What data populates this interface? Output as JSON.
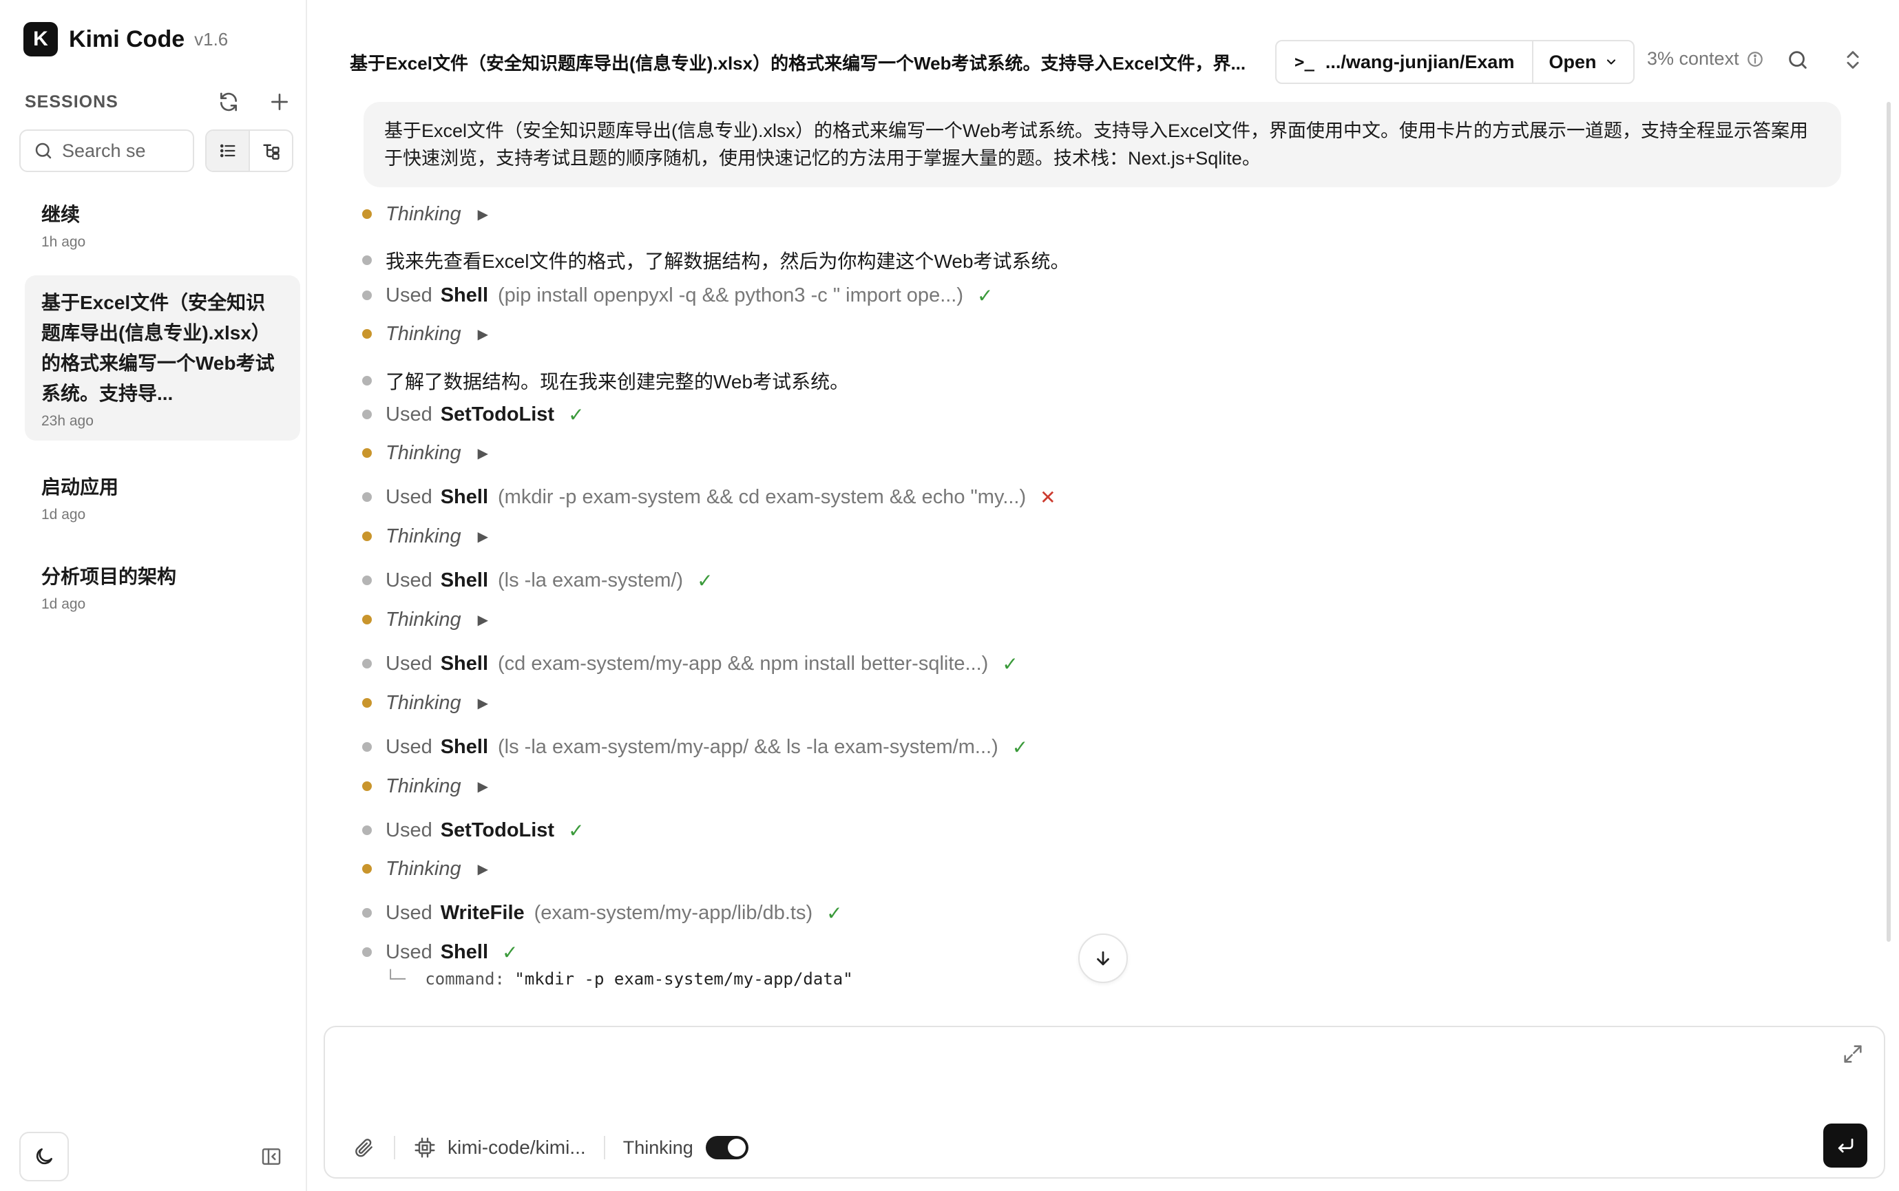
{
  "app": {
    "name": "Kimi Code",
    "version": "v1.6",
    "logo_letter": "K"
  },
  "sidebar": {
    "sessions_title": "SESSIONS",
    "search_placeholder": "Search se",
    "sessions": [
      {
        "title": "继续",
        "time": "1h ago",
        "active": false
      },
      {
        "title": "基于Excel文件（安全知识题库导出(信息专业).xlsx）的格式来编写一个Web考试系统。支持导...",
        "time": "23h ago",
        "active": true
      },
      {
        "title": "启动应用",
        "time": "1d ago",
        "active": false
      },
      {
        "title": "分析项目的架构",
        "time": "1d ago",
        "active": false
      }
    ]
  },
  "header": {
    "title": "基于Excel文件（安全知识题库导出(信息专业).xlsx）的格式来编写一个Web考试系统。支持导入Excel文件，界...",
    "path_prompt": ">_",
    "path": ".../wang-junjian/Exam",
    "open_label": "Open",
    "context": "3% context"
  },
  "user_message": "基于Excel文件（安全知识题库导出(信息专业).xlsx）的格式来编写一个Web考试系统。支持导入Excel文件，界面使用中文。使用卡片的方式展示一道题，支持全程显示答案用于快速浏览，支持考试且题的顺序随机，使用快速记忆的方法用于掌握大量的题。技术栈：Next.js+Sqlite。",
  "steps": [
    {
      "kind": "thinking",
      "label": "Thinking",
      "arrow": "▶"
    },
    {
      "kind": "text",
      "text": "我来先查看Excel文件的格式，了解数据结构，然后为你构建这个Web考试系统。"
    },
    {
      "kind": "tool",
      "used": "Used",
      "tool": "Shell",
      "args": "(pip install openpyxl -q && python3 -c \" import ope...)",
      "status": "✓"
    },
    {
      "kind": "thinking",
      "label": "Thinking",
      "arrow": "▶"
    },
    {
      "kind": "text",
      "text": "了解了数据结构。现在我来创建完整的Web考试系统。"
    },
    {
      "kind": "tool",
      "used": "Used",
      "tool": "SetTodoList",
      "args": "",
      "status": "✓"
    },
    {
      "kind": "thinking",
      "label": "Thinking",
      "arrow": "▶"
    },
    {
      "kind": "tool",
      "used": "Used",
      "tool": "Shell",
      "args": "(mkdir -p exam-system && cd exam-system && echo \"my...)",
      "status": "✕"
    },
    {
      "kind": "thinking",
      "label": "Thinking",
      "arrow": "▶"
    },
    {
      "kind": "tool",
      "used": "Used",
      "tool": "Shell",
      "args": "(ls -la exam-system/)",
      "status": "✓"
    },
    {
      "kind": "thinking",
      "label": "Thinking",
      "arrow": "▶"
    },
    {
      "kind": "tool",
      "used": "Used",
      "tool": "Shell",
      "args": "(cd exam-system/my-app && npm install better-sqlite...)",
      "status": "✓"
    },
    {
      "kind": "thinking",
      "label": "Thinking",
      "arrow": "▶"
    },
    {
      "kind": "tool",
      "used": "Used",
      "tool": "Shell",
      "args": "(ls -la exam-system/my-app/ && ls -la exam-system/m...)",
      "status": "✓"
    },
    {
      "kind": "thinking",
      "label": "Thinking",
      "arrow": "▶"
    },
    {
      "kind": "tool",
      "used": "Used",
      "tool": "SetTodoList",
      "args": "",
      "status": "✓"
    },
    {
      "kind": "thinking",
      "label": "Thinking",
      "arrow": "▶"
    },
    {
      "kind": "tool",
      "used": "Used",
      "tool": "WriteFile",
      "args": "(exam-system/my-app/lib/db.ts)",
      "status": "✓"
    },
    {
      "kind": "tool",
      "used": "Used",
      "tool": "Shell",
      "args": "",
      "status": "✓"
    }
  ],
  "command_detail": {
    "tree": "└─",
    "key": "command:",
    "value": "\"mkdir -p exam-system/my-app/data\""
  },
  "composer": {
    "placeholder": "",
    "model": "kimi-code/kimi...",
    "thinking_label": "Thinking",
    "thinking_on": true
  },
  "colors": {
    "thinking_dot": "#c9952c",
    "step_dot": "#b4b4b4",
    "success": "#3a9a3a",
    "error": "#cc3b2f"
  }
}
